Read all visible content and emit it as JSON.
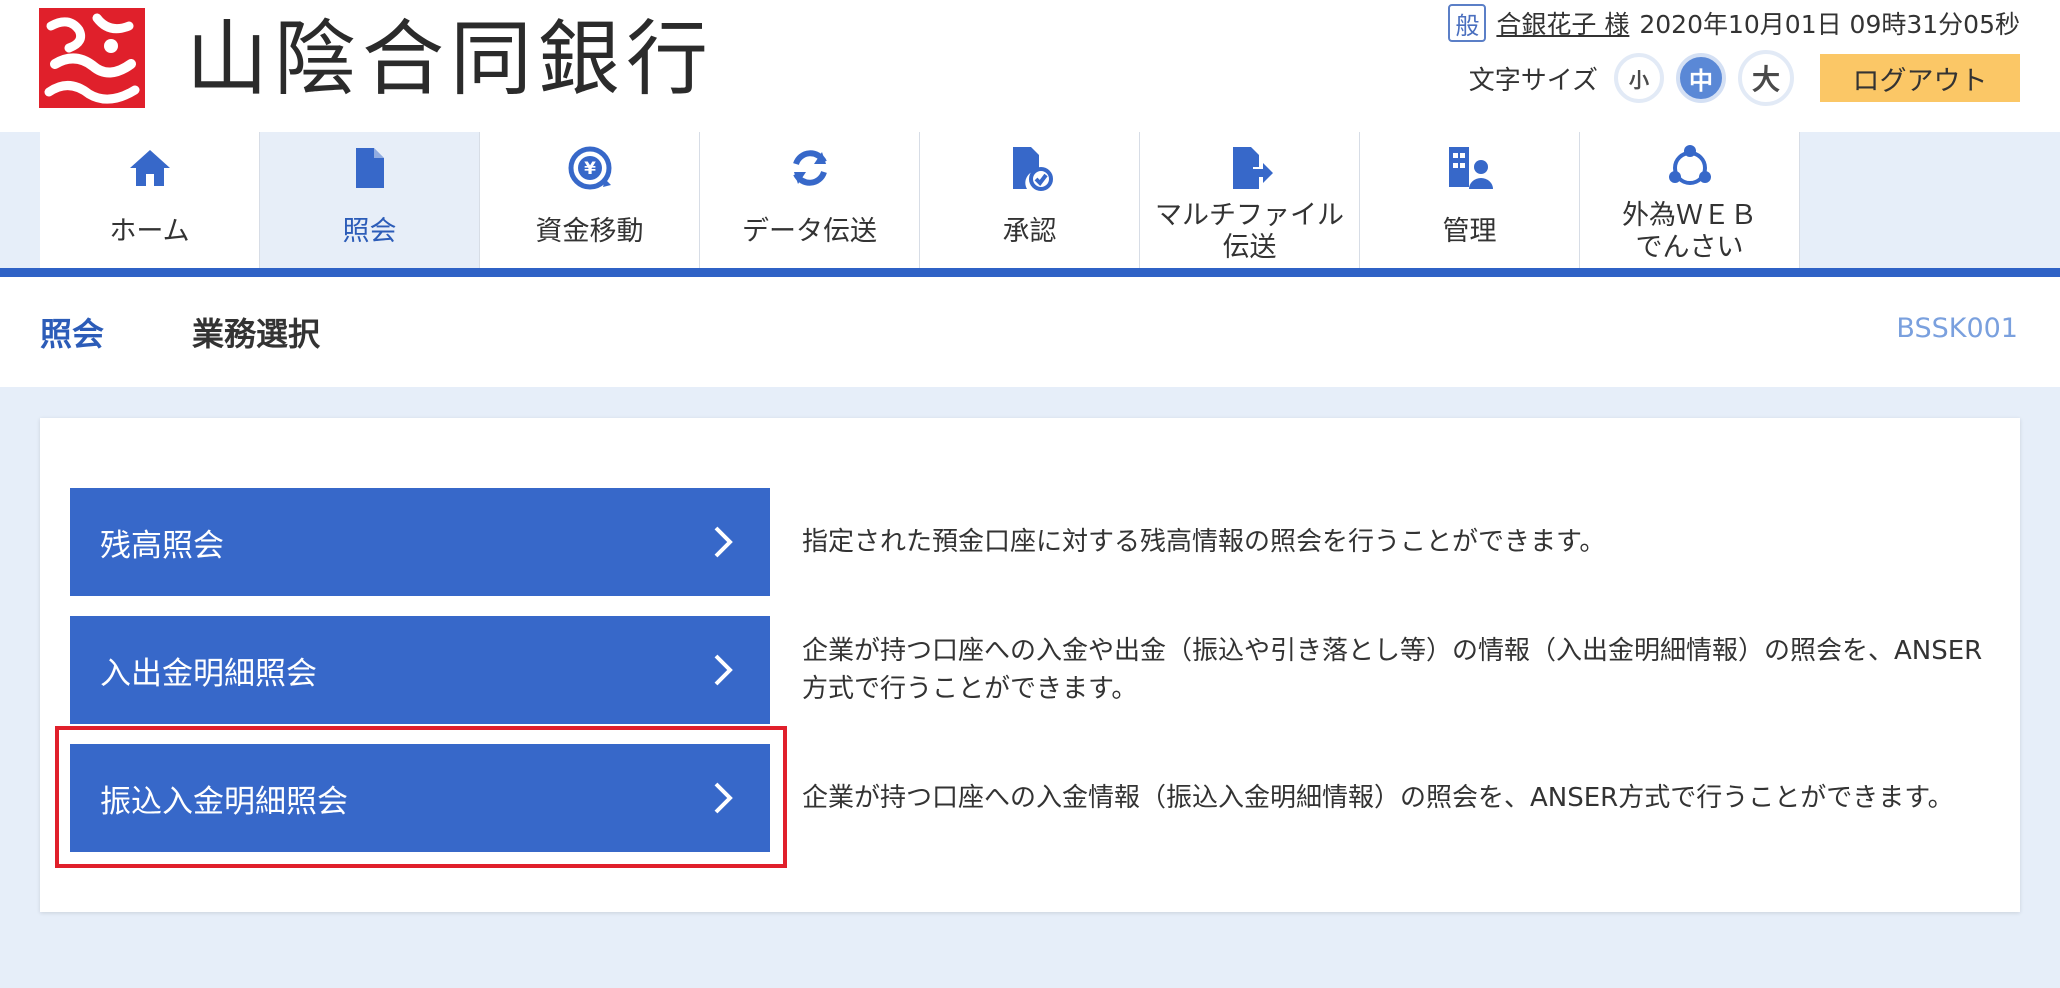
{
  "header": {
    "bank_name": "山陰合同銀行",
    "user_badge": "般",
    "user_name": "合銀花子 様",
    "datetime": "2020年10月01日 09時31分05秒",
    "font_size_label": "文字サイズ",
    "font_small": "小",
    "font_medium": "中",
    "font_large": "大",
    "logout_label": "ログアウト"
  },
  "nav": [
    {
      "label": "ホーム",
      "icon": "home-icon"
    },
    {
      "label": "照会",
      "icon": "document-icon"
    },
    {
      "label": "資金移動",
      "icon": "yen-transfer-icon"
    },
    {
      "label": "データ伝送",
      "icon": "refresh-icon"
    },
    {
      "label": "承認",
      "icon": "approval-document-icon"
    },
    {
      "label": "マルチファイル\n伝送",
      "icon": "file-send-icon"
    },
    {
      "label": "管理",
      "icon": "admin-user-icon"
    },
    {
      "label": "外為ＷＥＢ\nでんさい",
      "icon": "network-icon"
    }
  ],
  "page": {
    "category": "照会",
    "title": "業務選択",
    "screen_id": "BSSK001"
  },
  "menu": [
    {
      "label": "残高照会",
      "description": "指定された預金口座に対する残高情報の照会を行うことができます。"
    },
    {
      "label": "入出金明細照会",
      "description": "企業が持つ口座への入金や出金（振込や引き落とし等）の情報（入出金明細情報）の照会を、ANSER方式で行うことができます。"
    },
    {
      "label": "振込入金明細照会",
      "description": "企業が持つ口座への入金情報（振込入金明細情報）の照会を、ANSER方式で行うことができます。"
    }
  ],
  "colors": {
    "accent": "#3768c9",
    "nav_rule": "#2f62c6",
    "logout": "#fbc766",
    "highlight": "#e0202b",
    "logo_red": "#e0202b"
  }
}
